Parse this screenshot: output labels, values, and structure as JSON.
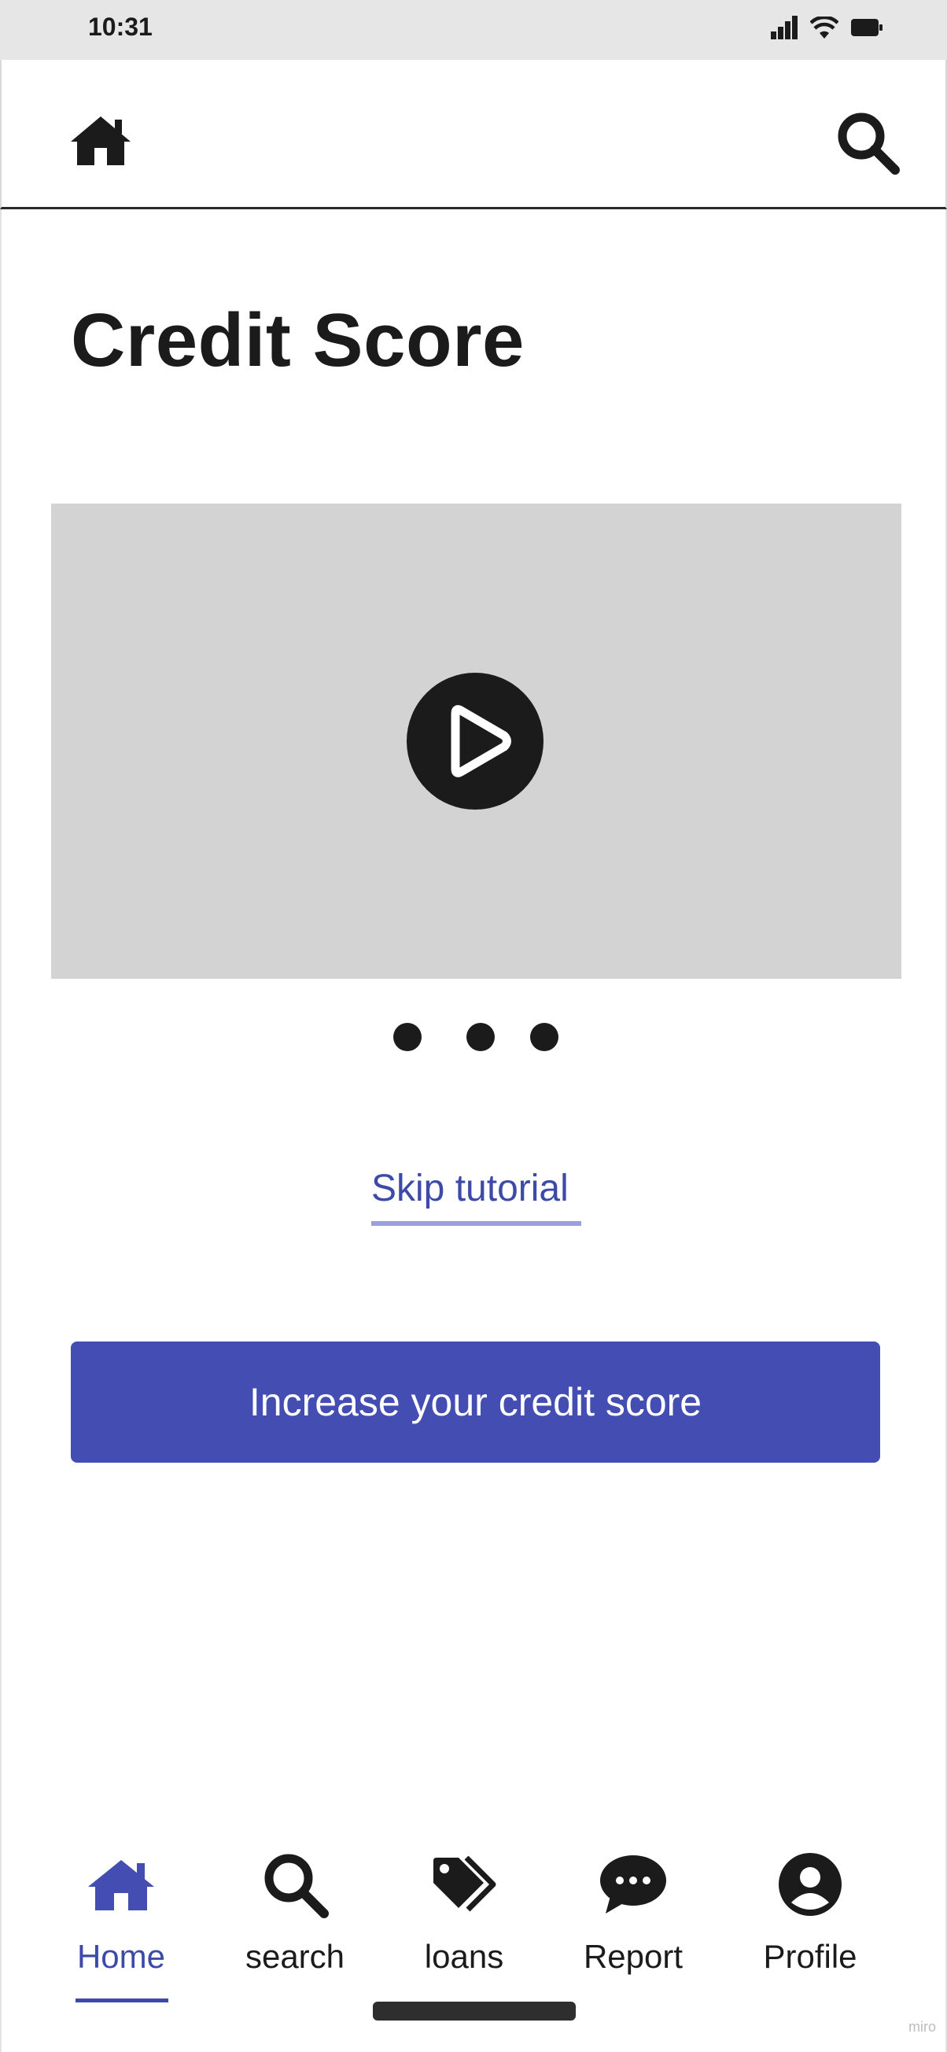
{
  "status_bar": {
    "time": "10:31",
    "icons": [
      "signal-icon",
      "wifi-icon",
      "battery-icon"
    ]
  },
  "header": {
    "home_icon": "home-icon",
    "search_icon": "search-icon"
  },
  "page": {
    "title": "Credit Score"
  },
  "video": {
    "play_icon": "play-icon",
    "pagination_count": 3
  },
  "skip_link": "Skip tutorial",
  "cta_button": "Increase your credit score",
  "bottom_nav": {
    "items": [
      {
        "label": "Home",
        "icon": "home-icon",
        "active": true
      },
      {
        "label": "search",
        "icon": "search-icon",
        "active": false
      },
      {
        "label": "loans",
        "icon": "tag-icon",
        "active": false
      },
      {
        "label": "Report",
        "icon": "chat-bubble-icon",
        "active": false
      },
      {
        "label": "Profile",
        "icon": "profile-icon",
        "active": false
      }
    ]
  },
  "colors": {
    "accent": "#434db2",
    "accent_text": "#3e4aa8",
    "video_placeholder": "#d3d3d3",
    "status_bar": "#e6e6e6"
  },
  "watermark": "miro"
}
